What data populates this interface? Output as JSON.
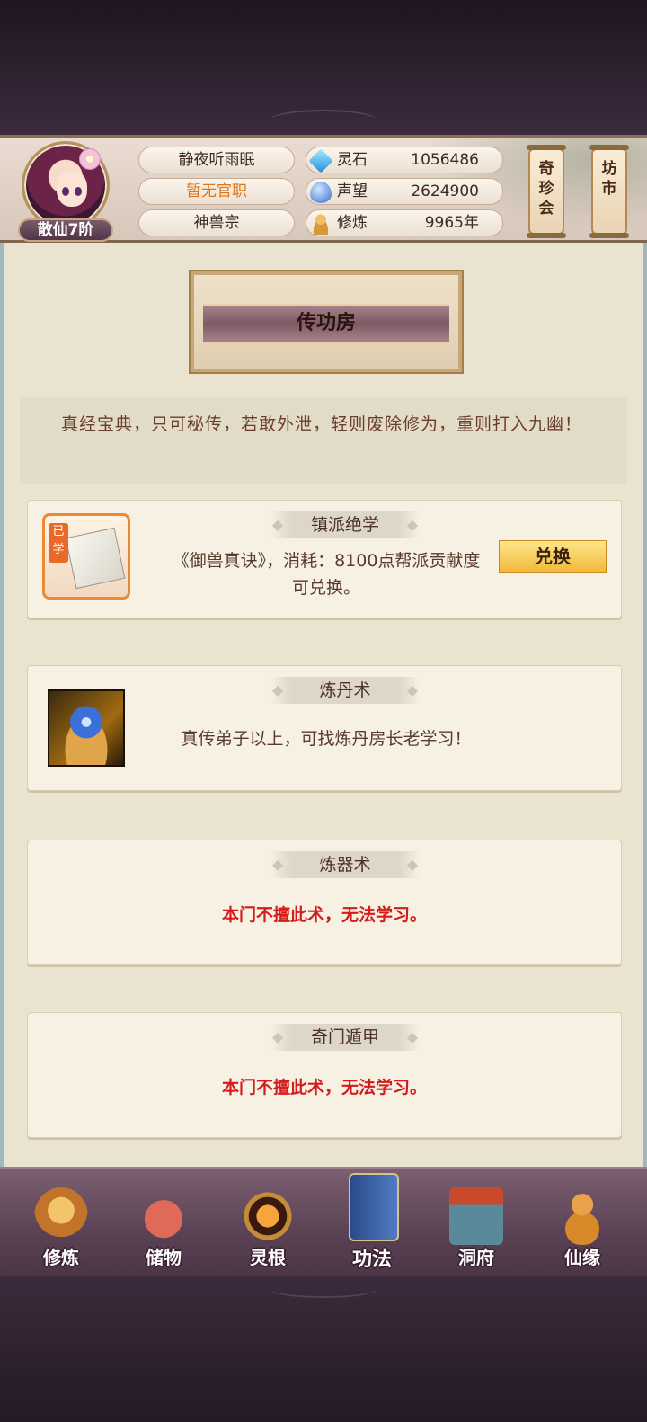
{
  "header": {
    "rank_badge": "散仙7阶",
    "player_name": "静夜听雨眠",
    "official_title": "暂无官职",
    "sect": "神兽宗",
    "stats": [
      {
        "icon": "crystal-icon",
        "label": "灵石",
        "value": "1056486"
      },
      {
        "icon": "reputation-icon",
        "label": "声望",
        "value": "2624900"
      },
      {
        "icon": "cultivation-icon",
        "label": "修炼",
        "value": "9965年"
      }
    ],
    "treasure_button": "奇珍会",
    "market_button": "坊市"
  },
  "page": {
    "title": "传功房",
    "intro": "真经宝典，只可秘传，若敢外泄，轻则废除修为，重则打入九幽！"
  },
  "skills": [
    {
      "title": "镇派绝学",
      "learned_tag": "已学",
      "desc": "《御兽真诀》，消耗：8100点帮派贡献度可兑换。",
      "button": "兑换"
    },
    {
      "title": "炼丹术",
      "desc": "真传弟子以上，可找炼丹房长老学习！"
    },
    {
      "title": "炼器术",
      "desc": "本门不擅此术，无法学习。"
    },
    {
      "title": "奇门遁甲",
      "desc": "本门不擅此术，无法学习。"
    }
  ],
  "nav": [
    {
      "label": "修炼",
      "icon": "monk-icon"
    },
    {
      "label": "储物",
      "icon": "bag-icon"
    },
    {
      "label": "灵根",
      "icon": "spirit-root-icon"
    },
    {
      "label": "功法",
      "icon": "book-icon"
    },
    {
      "label": "洞府",
      "icon": "cave-house-icon"
    },
    {
      "label": "仙缘",
      "icon": "gourd-icon"
    }
  ]
}
